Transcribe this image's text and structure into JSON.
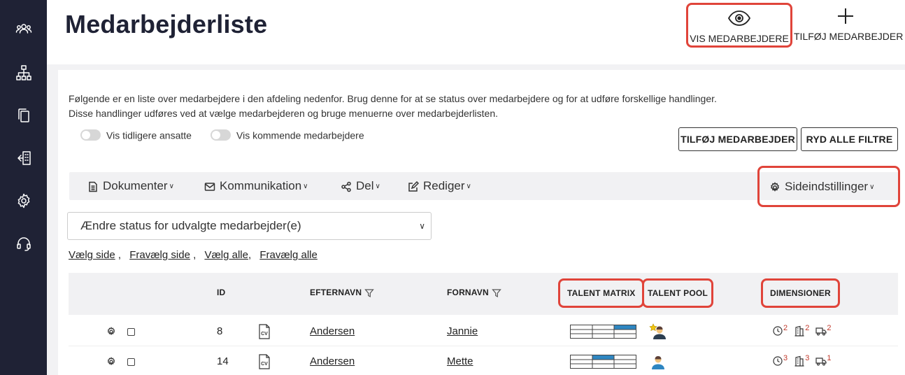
{
  "header": {
    "title": "Medarbejderliste",
    "actions": [
      {
        "label": "VIS MEDARBEJDERE",
        "icon": "eye-icon"
      },
      {
        "label": "TILFØJ MEDARBEJDER",
        "icon": "plus-icon"
      }
    ]
  },
  "sidebar": {
    "icons": [
      "users-icon",
      "org-chart-icon",
      "documents-icon",
      "building-exit-icon",
      "gear-icon",
      "headset-icon"
    ]
  },
  "intro": {
    "line1": "Følgende er en liste over medarbejdere i den afdeling nedenfor. Brug denne for at se status over medarbejdere og for at udføre forskellige handlinger.",
    "line2": "Disse handlinger udføres ved at vælge medarbejderen og bruge menuerne over medarbejderlisten."
  },
  "toggles": [
    {
      "label": "Vis tidligere ansatte",
      "on": false
    },
    {
      "label": "Vis kommende medarbejdere",
      "on": false
    }
  ],
  "buttons": {
    "add_employee": "TILFØJ MEDARBEJDER",
    "clear_filters": "RYD ALLE FILTRE"
  },
  "toolbar": {
    "items": [
      {
        "label": "Dokumenter",
        "icon": "document-icon"
      },
      {
        "label": "Kommunikation",
        "icon": "mail-icon"
      },
      {
        "label": "Del",
        "icon": "share-icon"
      },
      {
        "label": "Rediger",
        "icon": "edit-icon"
      }
    ],
    "settings": {
      "label": "Sideindstillinger",
      "icon": "gear-icon"
    }
  },
  "status_select": {
    "selected": "Ændre status for udvalgte medarbejder(e)"
  },
  "selection_links": [
    "Vælg side",
    "Fravælg side",
    "Vælg alle",
    "Fravælg alle"
  ],
  "table": {
    "columns": [
      "ID",
      "EFTERNAVN",
      "FORNAVN",
      "TALENT MATRIX",
      "TALENT POOL",
      "DIMENSIONER"
    ],
    "rows": [
      {
        "id": "8",
        "lastname": "Andersen",
        "firstname": "Jannie",
        "dim": [
          "2",
          "2",
          "2"
        ]
      },
      {
        "id": "14",
        "lastname": "Andersen",
        "firstname": "Mette",
        "dim": [
          "3",
          "3",
          "1"
        ]
      }
    ]
  },
  "colors": {
    "sidebar": "#1f2235",
    "highlight": "#e0443a",
    "matrix_fill": "#2e86c1",
    "superscript": "#c0392b"
  }
}
